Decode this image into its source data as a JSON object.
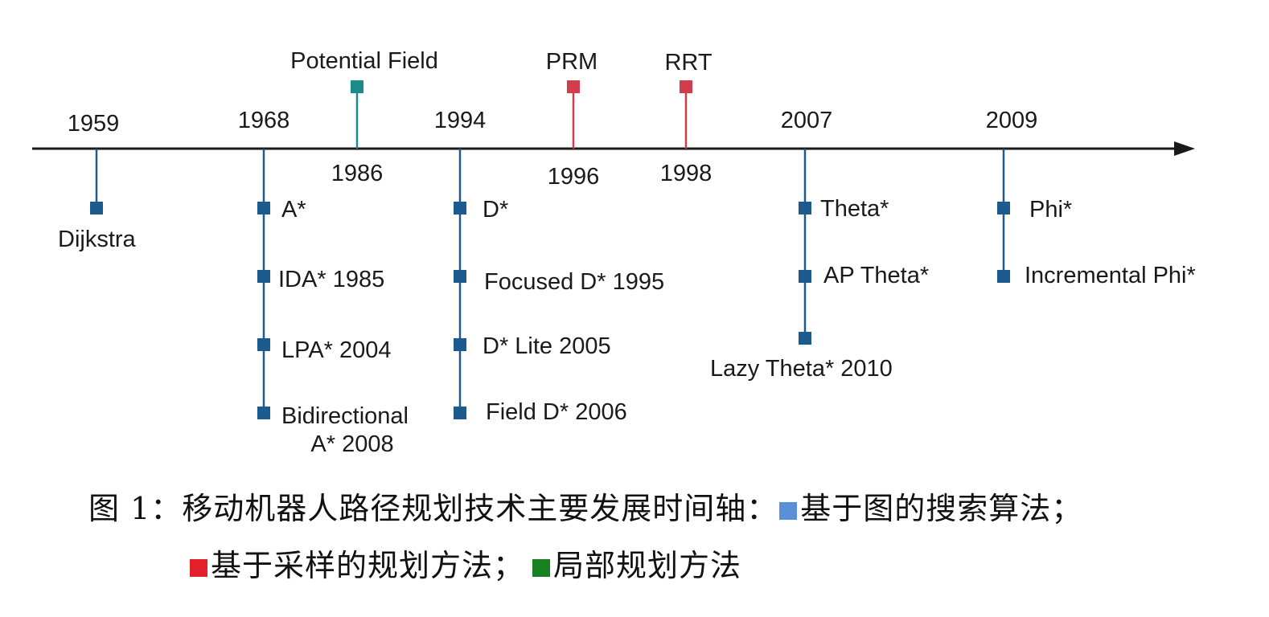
{
  "colors": {
    "axis": "#1a1a1a",
    "graph_search": "#1d5b8f",
    "sampling": "#d23d4b",
    "local": "#1b8c8c",
    "legend_graph_search": "#5b8fd8",
    "legend_sampling": "#e3202c",
    "legend_local": "#17801f"
  },
  "timeline": {
    "groups": [
      {
        "id": "1959",
        "year": "1959",
        "items": [
          "Dijkstra"
        ]
      },
      {
        "id": "1968",
        "year": "1968",
        "items": [
          "A*",
          "IDA* 1985",
          "LPA* 2004",
          "Bidirectional\nA* 2008"
        ]
      },
      {
        "id": "1994",
        "year": "1994",
        "items": [
          "D*",
          "Focused D* 1995",
          "D* Lite 2005",
          "Field D* 2006"
        ]
      },
      {
        "id": "2007",
        "year": "2007",
        "items": [
          "Theta*",
          "AP Theta*",
          "Lazy Theta* 2010"
        ]
      },
      {
        "id": "2009",
        "year": "2009",
        "items": [
          "Phi*",
          "Incremental Phi*"
        ]
      }
    ],
    "above_items": [
      {
        "id": "1986",
        "year": "1986",
        "label": "Potential Field",
        "category": "local"
      },
      {
        "id": "1996",
        "year": "1996",
        "label": "PRM",
        "category": "sampling"
      },
      {
        "id": "1998",
        "year": "1998",
        "label": "RRT",
        "category": "sampling"
      }
    ]
  },
  "caption": {
    "line1": "图 1：移动机器人路径规划技术主要发展时间轴：",
    "legend_graph_search": "基于图的搜索算法；",
    "legend_sampling": "基于采样的规划方法；",
    "legend_local": "局部规划方法"
  }
}
